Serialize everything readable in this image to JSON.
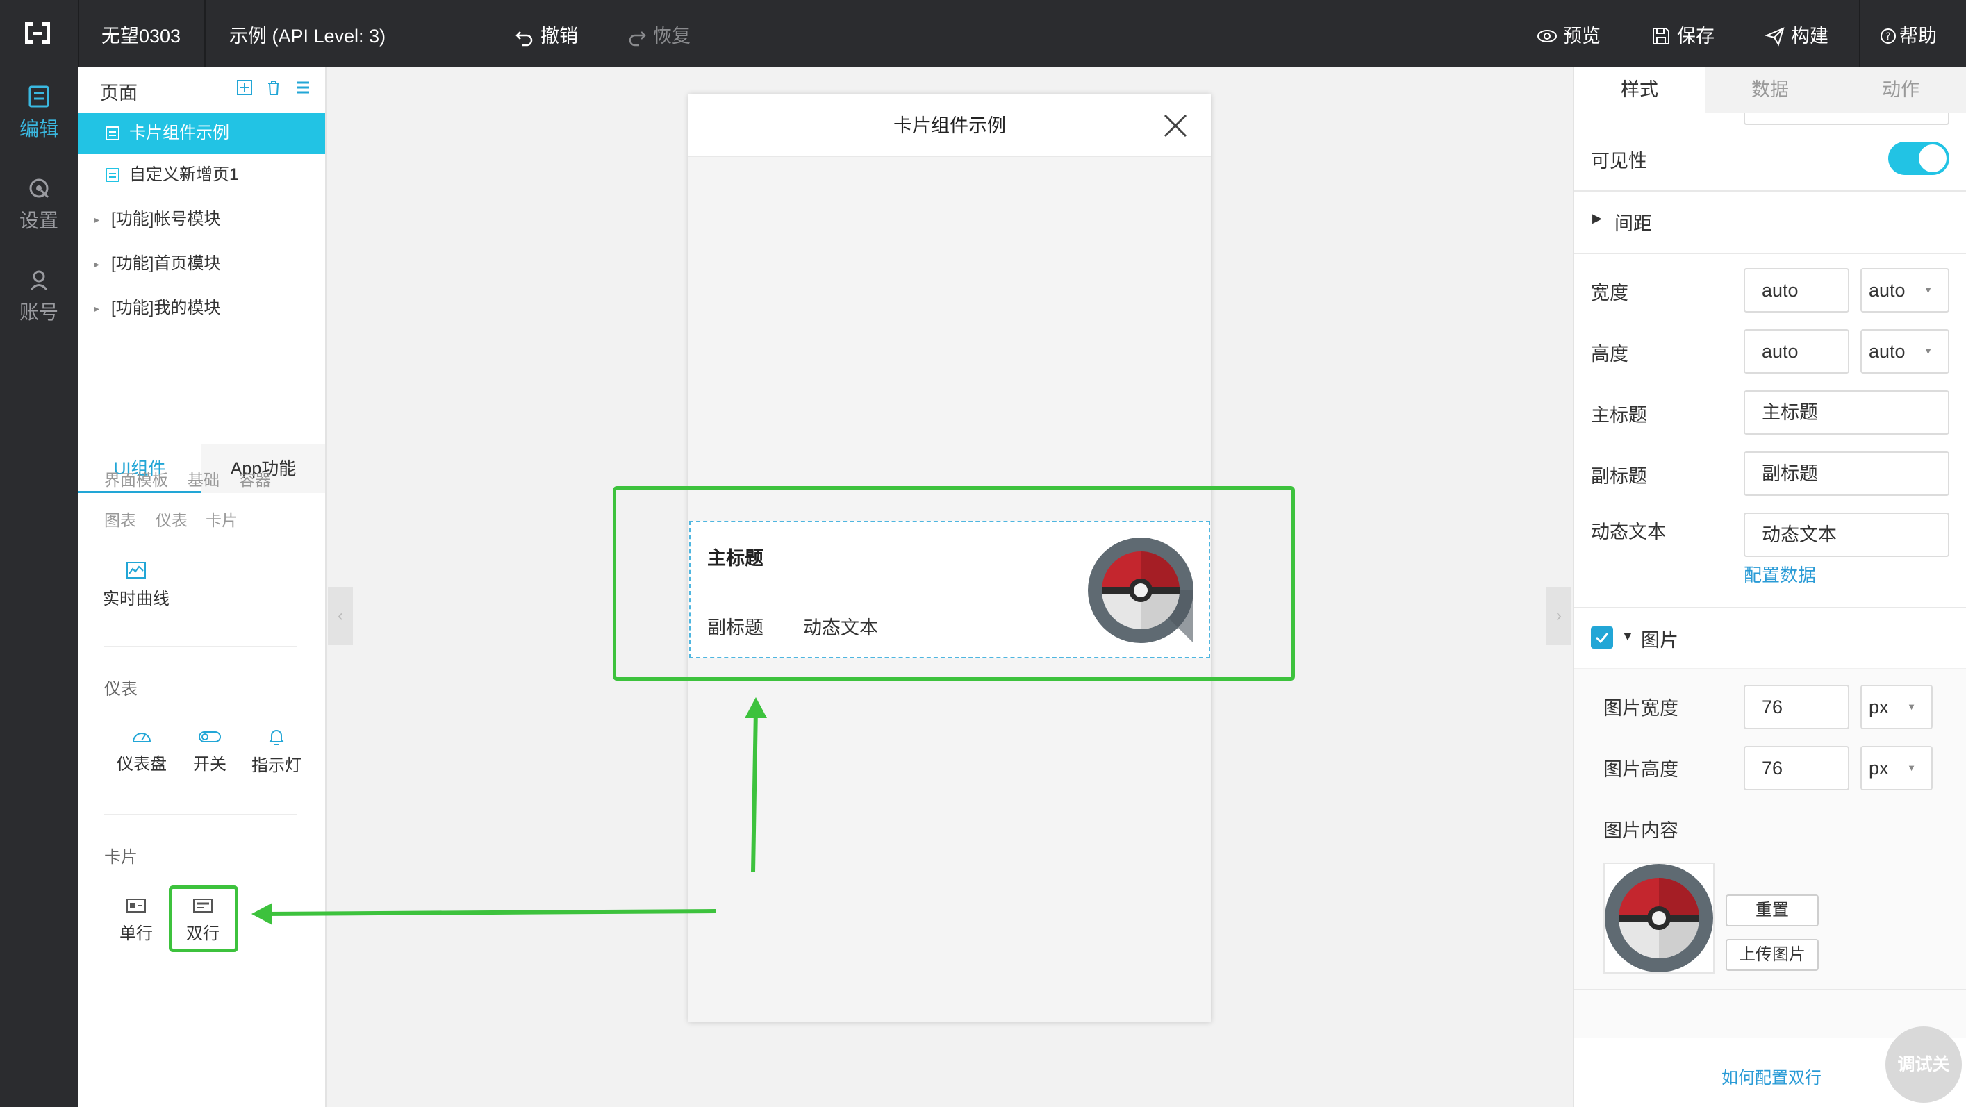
{
  "topbar": {
    "project_name": "无望0303",
    "app_title": "示例 (API Level: 3)",
    "undo_label": "撤销",
    "redo_label": "恢复",
    "preview_label": "预览",
    "save_label": "保存",
    "build_label": "构建",
    "help_label": "帮助"
  },
  "leftnav": {
    "items": [
      {
        "label": "编辑",
        "icon": "edit-icon"
      },
      {
        "label": "设置",
        "icon": "settings-icon"
      },
      {
        "label": "账号",
        "icon": "account-icon"
      }
    ]
  },
  "pages": {
    "header": "页面",
    "items": [
      {
        "label": "卡片组件示例"
      },
      {
        "label": "自定义新增页1"
      },
      {
        "label": "[功能]帐号模块"
      },
      {
        "label": "[功能]首页模块"
      },
      {
        "label": "[功能]我的模块"
      }
    ]
  },
  "components": {
    "tabs": [
      "UI组件",
      "App功能"
    ],
    "categories_row1": [
      "界面模板",
      "基础",
      "容器"
    ],
    "categories_row2": [
      "图表",
      "仪表",
      "卡片"
    ],
    "chart_widget": "实时曲线",
    "gauge_section": "仪表",
    "gauge_widgets": [
      "仪表盘",
      "开关",
      "指示灯"
    ],
    "card_section": "卡片",
    "card_widgets": [
      "单行",
      "双行"
    ]
  },
  "canvas": {
    "page_title": "卡片组件示例",
    "card": {
      "title": "主标题",
      "subtitle": "副标题",
      "dynamic_text": "动态文本"
    }
  },
  "props": {
    "tabs": [
      "样式",
      "数据",
      "动作"
    ],
    "visibility_label": "可见性",
    "visibility_on": true,
    "spacing_label": "间距",
    "width_label": "宽度",
    "width_value": "auto",
    "width_unit": "auto",
    "height_label": "高度",
    "height_value": "auto",
    "height_unit": "auto",
    "title_label": "主标题",
    "title_value": "主标题",
    "subtitle_label": "副标题",
    "subtitle_value": "副标题",
    "dynamic_label": "动态文本",
    "dynamic_value": "动态文本",
    "config_data_link": "配置数据",
    "image_section": "图片",
    "image_width_label": "图片宽度",
    "image_width_value": "76",
    "image_width_unit": "px",
    "image_height_label": "图片高度",
    "image_height_value": "76",
    "image_height_unit": "px",
    "image_content_label": "图片内容",
    "reset_button": "重置",
    "upload_button": "上传图片",
    "help_link": "如何配置双行",
    "debug_label": "调试关"
  },
  "colors": {
    "accent": "#22c3e4",
    "highlight": "#3dc23d",
    "topbar": "#2b2c2f"
  }
}
